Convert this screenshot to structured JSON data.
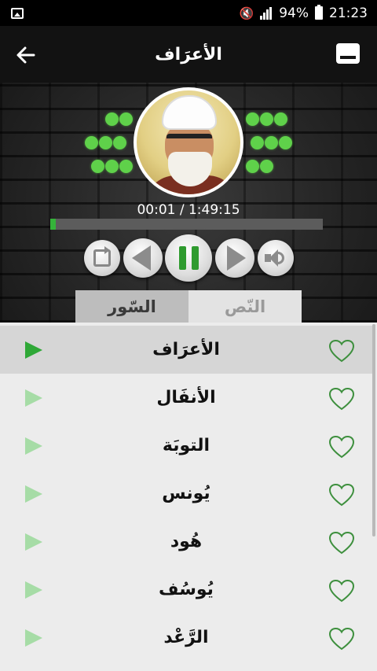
{
  "status_bar": {
    "battery": "94%",
    "time": "21:23"
  },
  "header": {
    "title": "الأعرَاف"
  },
  "player": {
    "time_display": "00:01 / 1:49:15",
    "progress_fraction": 0.02
  },
  "tabs": [
    {
      "label": "السّور",
      "active": true
    },
    {
      "label": "النّص",
      "active": false
    }
  ],
  "suras": [
    {
      "title": "الأعرَاف",
      "selected": true
    },
    {
      "title": "الأنفَال",
      "selected": false
    },
    {
      "title": "التوبَة",
      "selected": false
    },
    {
      "title": "يُونس",
      "selected": false
    },
    {
      "title": "هُود",
      "selected": false
    },
    {
      "title": "يُوسُف",
      "selected": false
    },
    {
      "title": "الرَّعْد",
      "selected": false
    }
  ],
  "colors": {
    "accent_green": "#35b33a",
    "dot_green": "#5fd14a",
    "play_inactive": "#a6dca6",
    "heart_outline": "#3d8f3d"
  }
}
